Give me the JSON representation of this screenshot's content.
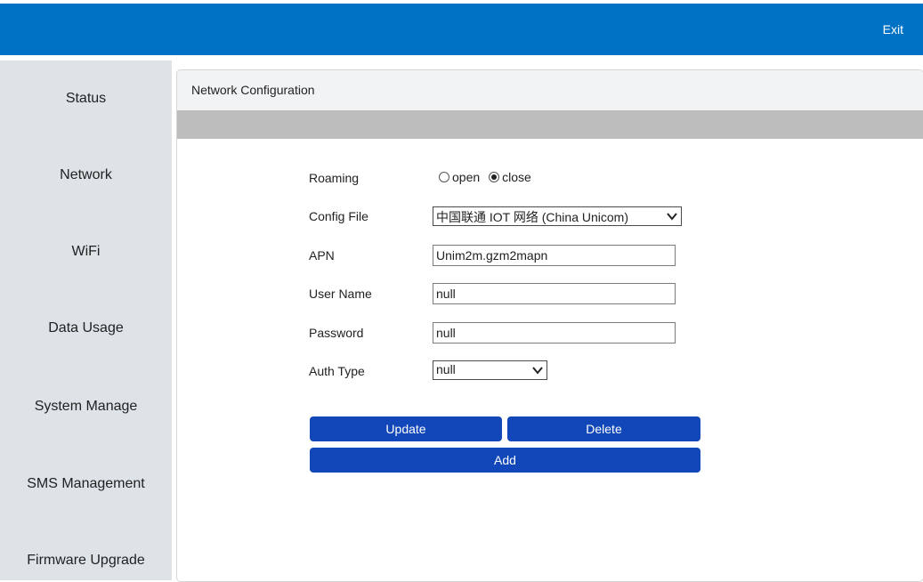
{
  "header": {
    "exit_label": "Exit",
    "brand_color": "#0072c6"
  },
  "sidebar": {
    "items": [
      {
        "label": "Status"
      },
      {
        "label": "Network"
      },
      {
        "label": "WiFi"
      },
      {
        "label": "Data Usage"
      },
      {
        "label": "System Manage"
      },
      {
        "label": "SMS Management"
      },
      {
        "label": "Firmware Upgrade"
      }
    ]
  },
  "panel": {
    "title": "Network Configuration"
  },
  "form": {
    "roaming": {
      "label": "Roaming",
      "options": [
        "open",
        "close"
      ],
      "selected": "close"
    },
    "config_file": {
      "label": "Config File",
      "selected": "中国联通 IOT 网络 (China Unicom)"
    },
    "apn": {
      "label": "APN",
      "value": "Unim2m.gzm2mapn"
    },
    "user_name": {
      "label": "User Name",
      "value": "null"
    },
    "password": {
      "label": "Password",
      "value": "null"
    },
    "auth_type": {
      "label": "Auth Type",
      "selected": "null"
    }
  },
  "buttons": {
    "update": "Update",
    "delete": "Delete",
    "add": "Add",
    "color": "#1147b8"
  },
  "icons": {
    "dropdown": "chevron-down-icon",
    "radio": "radio-icon"
  }
}
